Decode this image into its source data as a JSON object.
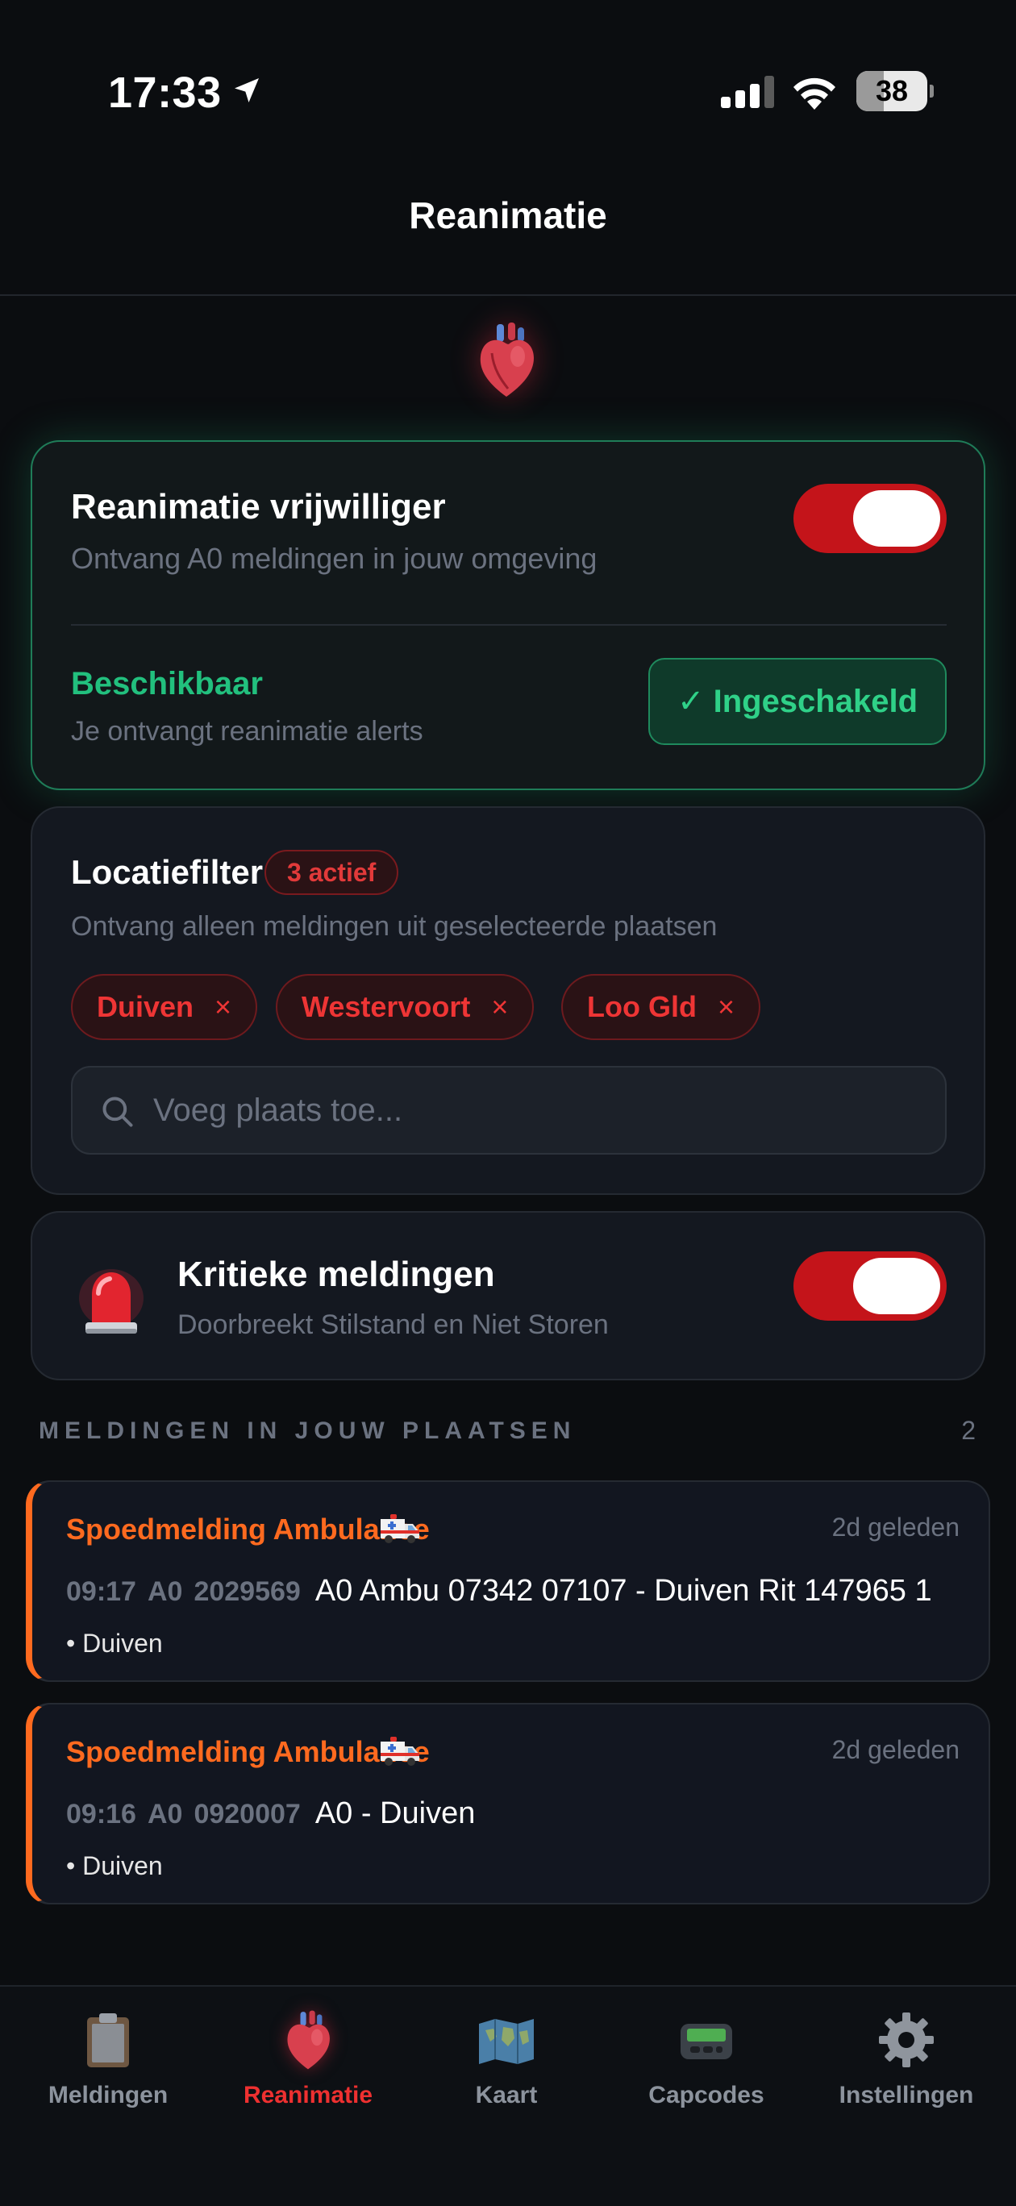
{
  "status_bar": {
    "time": "17:33",
    "battery": "38"
  },
  "header": {
    "title": "Reanimatie"
  },
  "volunteer": {
    "title": "Reanimatie vrijwilliger",
    "subtitle": "Ontvang A0 meldingen in jouw omgeving",
    "toggle_on": true,
    "availability_title": "Beschikbaar",
    "availability_subtitle": "Je ontvangt reanimatie alerts",
    "status_button": "✓ Ingeschakeld"
  },
  "location_filter": {
    "title": "Locatiefilter",
    "badge": "3 actief",
    "subtitle": "Ontvang alleen meldingen uit geselecteerde plaatsen",
    "chips": [
      "Duiven",
      "Westervoort",
      "Loo Gld"
    ],
    "chip_remove_symbol": "×",
    "search_placeholder": "Voeg plaats toe..."
  },
  "critical": {
    "title": "Kritieke meldingen",
    "subtitle": "Doorbreekt Stilstand en Niet Storen",
    "toggle_on": true
  },
  "alerts_section": {
    "title": "MELDINGEN IN JOUW PLAATSEN",
    "count": "2"
  },
  "alerts": [
    {
      "title": "Spoedmelding Ambulance",
      "age": "2d geleden",
      "time": "09:17",
      "priority": "A0",
      "capcode": "2029569",
      "message": "A0 Ambu 07342 07107 - Duiven Rit 147965 1",
      "place": "• Duiven"
    },
    {
      "title": "Spoedmelding Ambulance",
      "age": "2d geleden",
      "time": "09:16",
      "priority": "A0",
      "capcode": "0920007",
      "message": "A0 - Duiven",
      "place": "• Duiven"
    }
  ],
  "tabs": [
    {
      "label": "Meldingen",
      "icon": "clipboard-icon",
      "active": false
    },
    {
      "label": "Reanimatie",
      "icon": "anatomical-heart-icon",
      "active": true
    },
    {
      "label": "Kaart",
      "icon": "world-map-icon",
      "active": false
    },
    {
      "label": "Capcodes",
      "icon": "pager-icon",
      "active": false
    },
    {
      "label": "Instellingen",
      "icon": "gear-icon",
      "active": false
    }
  ],
  "colors": {
    "background": "#0b0d10",
    "accent_red": "#c4141a",
    "accent_green": "#22c07e",
    "accent_orange": "#ff6a1f"
  }
}
